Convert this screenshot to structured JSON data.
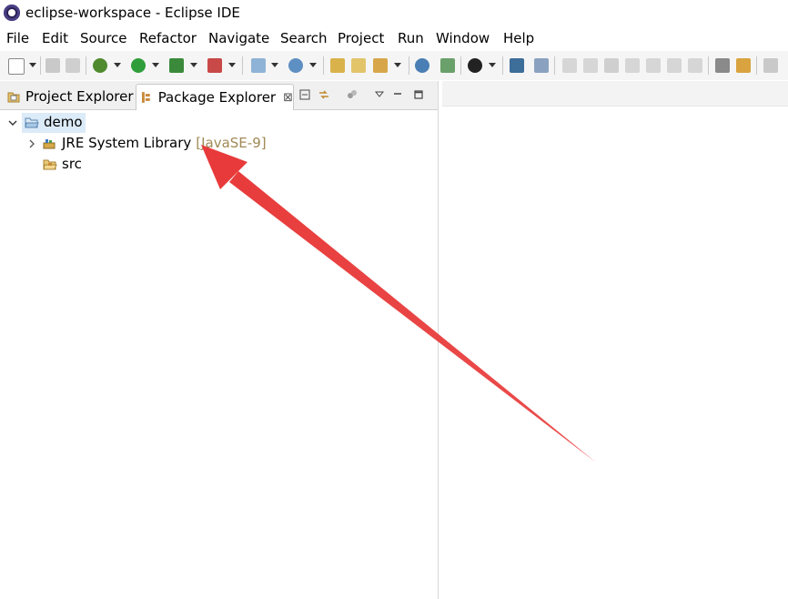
{
  "window": {
    "title": "eclipse-workspace - Eclipse IDE"
  },
  "menu": [
    "File",
    "Edit",
    "Source",
    "Refactor",
    "Navigate",
    "Search",
    "Project",
    "Run",
    "Window",
    "Help"
  ],
  "views": {
    "tabs": [
      {
        "label": "Project Explorer",
        "icon": "project-explorer-icon",
        "active": false
      },
      {
        "label": "Package Explorer",
        "icon": "package-explorer-icon",
        "active": true
      }
    ],
    "close_glyph": "⊠"
  },
  "tree": {
    "project": {
      "label": "demo",
      "icon": "open-project-folder-icon",
      "selected": true
    },
    "children": [
      {
        "label": "JRE System Library",
        "decoration": "[JavaSE-9]",
        "icon": "library-icon"
      },
      {
        "label": "src",
        "icon": "source-folder-icon"
      }
    ]
  },
  "annotation": {
    "color": "#e83a3a"
  }
}
